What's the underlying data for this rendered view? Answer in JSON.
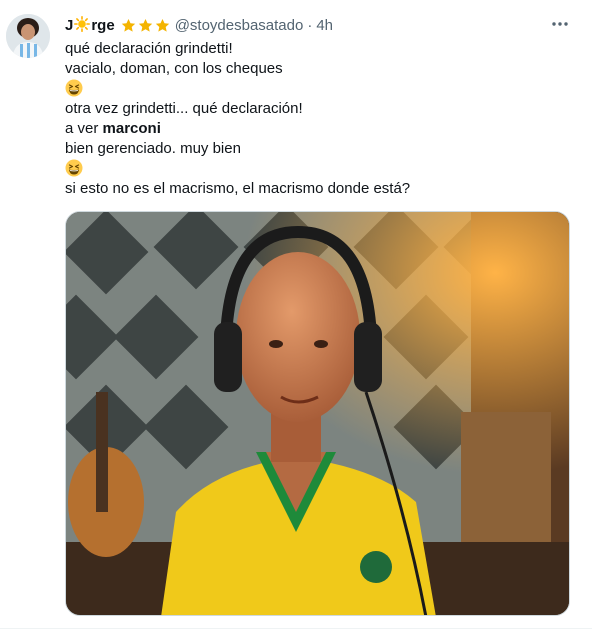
{
  "tweet": {
    "name_part1": "J",
    "name_part2": "rge",
    "handle": "@stoydesbasatado",
    "separator": "·",
    "time": "4h",
    "lines": {
      "l1": "qué declaración grindetti!",
      "l2": "vacialo, doman, con los cheques",
      "l3": "otra vez grindetti... qué declaración!",
      "l4_prefix": "a ver ",
      "l4_bold": "marconi",
      "l5": "bien gerenciado. muy bien",
      "l6": "si esto no es el macrismo, el macrismo donde está?"
    }
  },
  "icons": {
    "name_emoji": "sun-emoji-icon",
    "badges": "star-emoji-icon",
    "more": "more-dots-icon",
    "inline_emoji": "grinning-squinting-face-emoji-icon"
  },
  "colors": {
    "text": "#0f1419",
    "secondary": "#536471",
    "star": "#f4b400",
    "sun": "#ffc107"
  }
}
